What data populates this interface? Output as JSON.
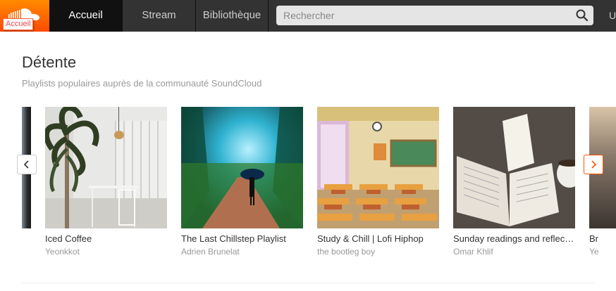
{
  "header": {
    "logo_tooltip": "Accueil",
    "nav": [
      {
        "label": "Accueil",
        "active": true
      },
      {
        "label": "Stream",
        "active": false
      },
      {
        "label": "Bibliothèque",
        "active": false
      }
    ],
    "search_placeholder": "Rechercher",
    "right_text": "U"
  },
  "section": {
    "title": "Détente",
    "subtitle": "Playlists populaires auprès de la communauté SoundCloud"
  },
  "playlists": [
    {
      "title": "Iced Coffee",
      "user": "Yeonkkot"
    },
    {
      "title": "The Last Chillstep Playlist",
      "user": "Adrien Brunelat"
    },
    {
      "title": "Study & Chill | Lofi Hiphop",
      "user": "the bootleg boy"
    },
    {
      "title": "Sunday readings and reflections",
      "user": "Omar Khlif"
    },
    {
      "title": "Br",
      "user": "Ye"
    }
  ],
  "colors": {
    "brand": "#ff5500",
    "topbar": "#333333"
  }
}
